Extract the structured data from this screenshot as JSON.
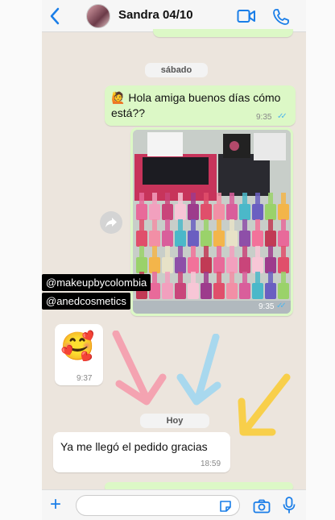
{
  "header": {
    "contact_name": "Sandra 04/10"
  },
  "chat": {
    "date_saturday": "sábado",
    "msg1_emoji": "🙋",
    "msg1_text_line1": "Hola amiga buenos días cómo",
    "msg1_text_line2": "está??",
    "msg1_time": "9:35",
    "photo_time": "9:35",
    "emoji_msg": "🥰",
    "emoji_time": "9:37",
    "date_today": "Hoy",
    "msg_last_text": "Ya me llegó el pedido gracias",
    "msg_last_time": "18:59"
  },
  "overlay": {
    "tag1": "@makeupbycolombia",
    "tag2": "@anedcosmetics"
  },
  "colors": {
    "outgoing_bubble": "#dcf8c6",
    "incoming_bubble": "#ffffff",
    "chat_bg": "#ece5dd",
    "ios_blue": "#1a7ee8",
    "arrow_pink": "#f4a3b1",
    "arrow_blue": "#a8d8ee",
    "arrow_yellow": "#f8cf4a"
  },
  "icons": {
    "back": "chevron-left-icon",
    "video": "video-camera-icon",
    "call": "phone-icon",
    "forward": "forward-icon",
    "plus": "plus-icon",
    "sticker": "sticker-icon",
    "camera": "camera-icon",
    "mic": "microphone-icon"
  }
}
